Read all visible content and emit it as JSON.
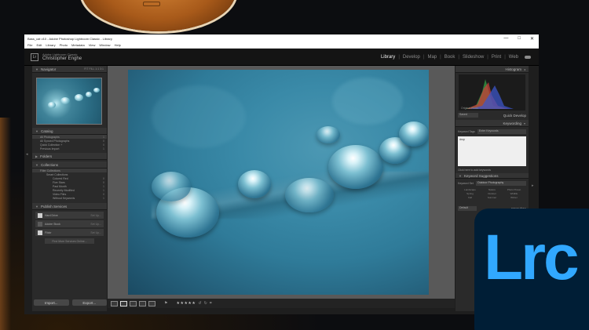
{
  "window": {
    "title": "Bass_cat v10 - Adobe Photoshop Lightroom Classic - Library",
    "controls": [
      "—",
      "□",
      "✕"
    ]
  },
  "menu": [
    "File",
    "Edit",
    "Library",
    "Photo",
    "Metadata",
    "View",
    "Window",
    "Help"
  ],
  "identity": {
    "plate_line1": "Adobe Lightroom Classic",
    "plate_line2": "Christopher Enghe"
  },
  "modules": [
    "Library",
    "Develop",
    "Map",
    "Book",
    "Slideshow",
    "Print",
    "Web"
  ],
  "active_module": "Library",
  "left_panel": {
    "navigator": {
      "title": "Navigator",
      "zoom": "FIT   FILL   1:1   3:1"
    },
    "catalog": {
      "title": "Catalog",
      "items": [
        {
          "label": "All Photographs",
          "count": "1"
        },
        {
          "label": "All Synced Photographs",
          "count": "0"
        },
        {
          "label": "Quick Collection +",
          "count": "0"
        },
        {
          "label": "Previous Import",
          "count": "1"
        }
      ]
    },
    "folders": {
      "title": "Folders"
    },
    "collections": {
      "title": "Collections",
      "items": [
        {
          "label": "Filter Collections",
          "count": ""
        },
        {
          "label": "Smart Collections",
          "count": ""
        },
        {
          "label": "Colored Red",
          "count": "0"
        },
        {
          "label": "Five Stars",
          "count": "0"
        },
        {
          "label": "Past Month",
          "count": "1"
        },
        {
          "label": "Recently Modified",
          "count": "1"
        },
        {
          "label": "Video Files",
          "count": "0"
        },
        {
          "label": "Without Keywords",
          "count": "1"
        }
      ]
    },
    "publish": {
      "title": "Publish Services",
      "items": [
        {
          "label": "Hard Drive",
          "right": "Set Up..."
        },
        {
          "label": "Adobe Stock",
          "right": "Set Up..."
        },
        {
          "label": "Flickr",
          "right": "Set Up..."
        }
      ],
      "find_more": "Find More Services Online..."
    },
    "import_label": "Import...",
    "export_label": "Export..."
  },
  "right_panel": {
    "histogram": {
      "title": "Histogram",
      "info": "Original Photo"
    },
    "quick_develop": {
      "preset": "Saved",
      "title": "Quick Develop"
    },
    "keywording": {
      "title": "Keywording",
      "tags_label": "Keyword Tags",
      "tags_value": "Enter Keywords",
      "keyword": "drop",
      "add_hint": "Click here to add keywords",
      "suggestions": "Keyword Suggestions",
      "set_label": "Keyword Set",
      "set_value": "Outdoor Photography",
      "grid": [
        "Landscape",
        "Nature",
        "Photo Preset",
        "Spring",
        "Outdoor",
        "Wildlife",
        "Fall",
        "Summer",
        "Winter"
      ]
    },
    "metadata": {
      "preset": "Default",
      "title": "Metadata"
    }
  },
  "toolbar": {
    "stars": "★★★★★"
  },
  "badge": {
    "text": "Lrc"
  },
  "colors": {
    "lrc_bg": "#001e36",
    "lrc_fg": "#31a8ff",
    "panel": "#2a2a2a"
  }
}
